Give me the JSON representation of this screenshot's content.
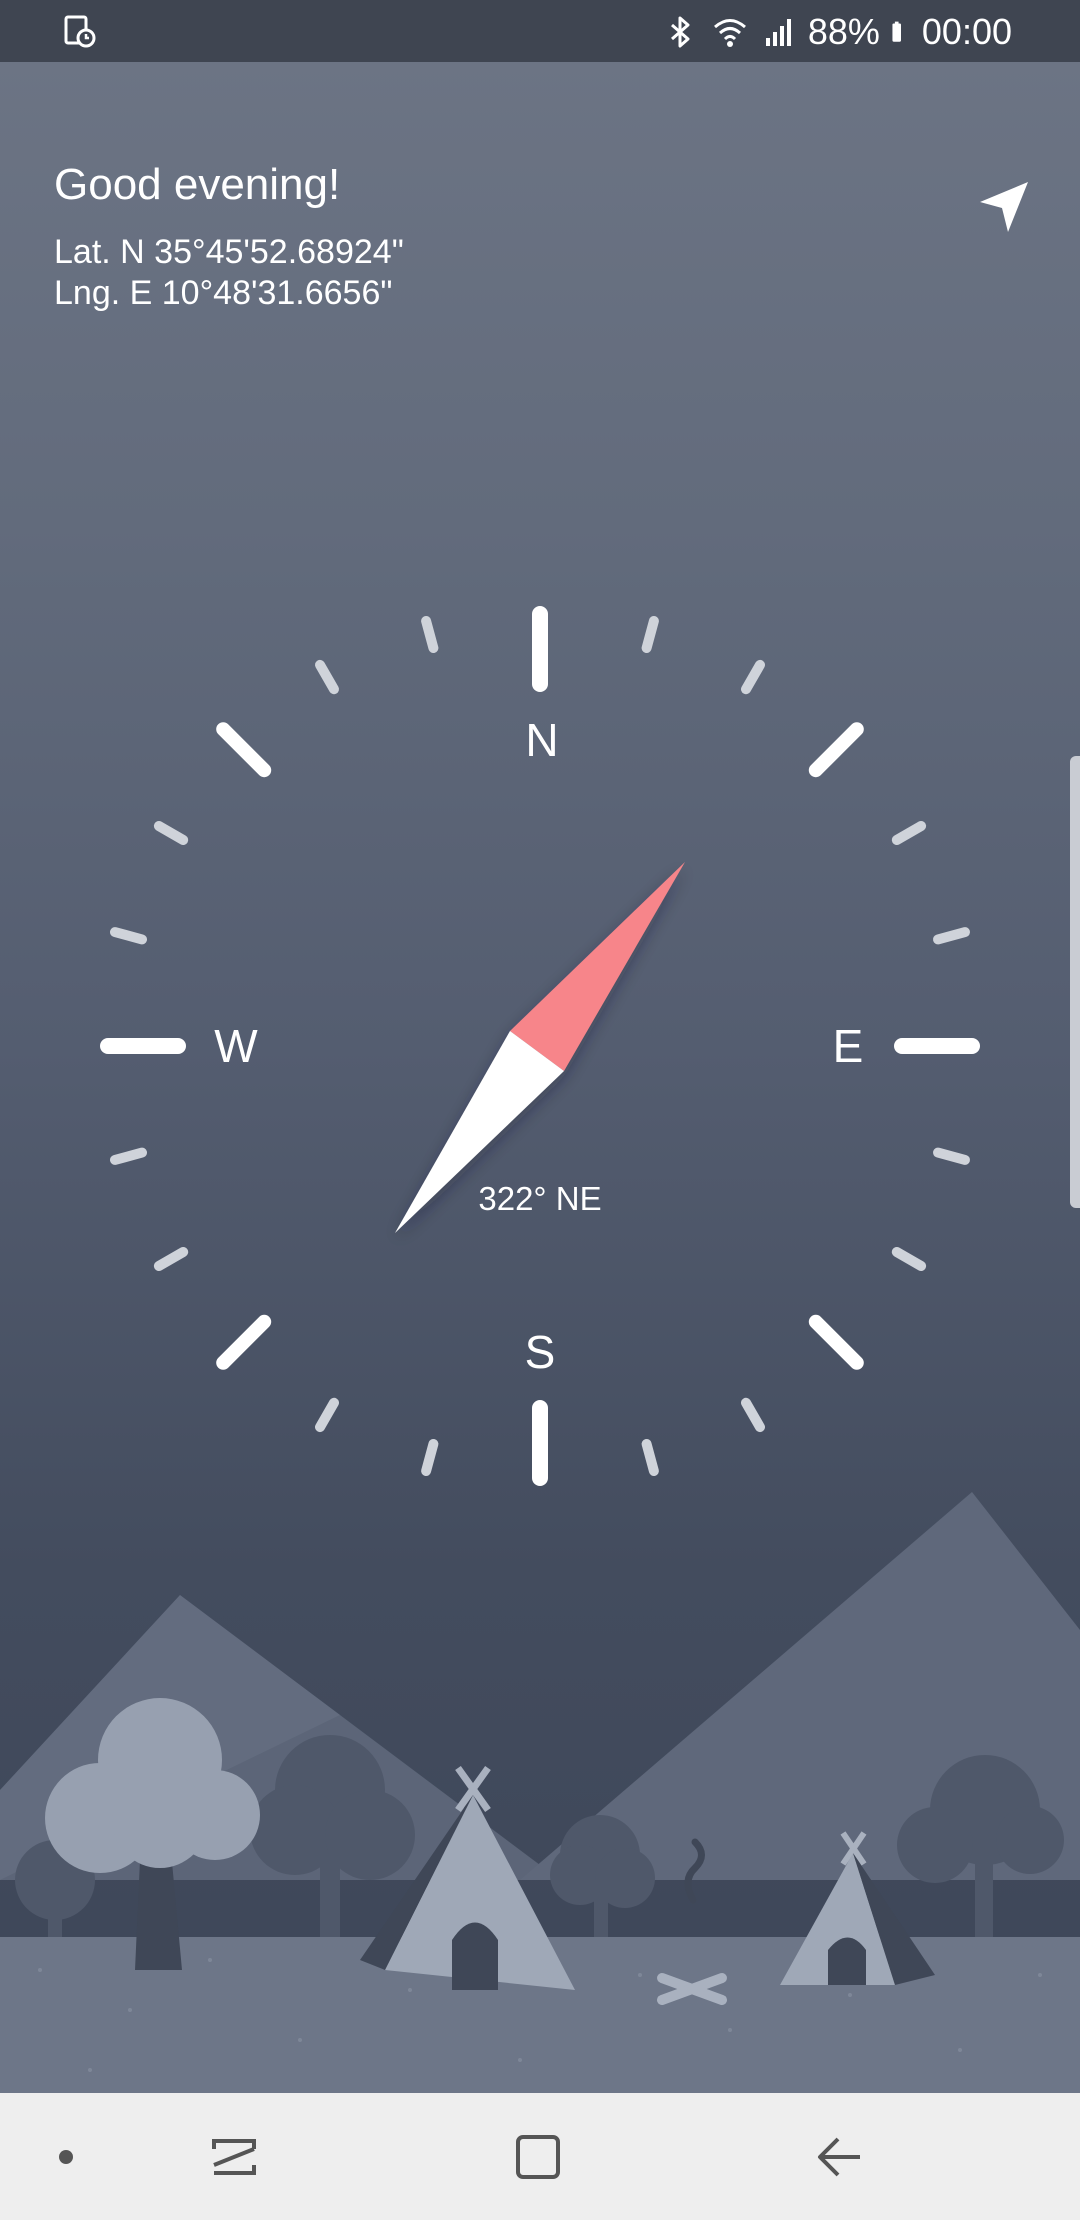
{
  "status_bar": {
    "left_icon": "screen-record-icon",
    "icons": [
      "bluetooth-icon",
      "wifi-icon",
      "signal-icon"
    ],
    "battery_percent": "88%",
    "battery_icon": "battery-icon",
    "time": "00:00"
  },
  "header": {
    "greeting": "Good evening!",
    "latitude": "Lat.  N 35°45'52.68924\"",
    "longitude": "Lng. E 10°48'31.6656\""
  },
  "location_button": {
    "icon": "location-arrow-icon"
  },
  "compass": {
    "cardinals": {
      "n": "N",
      "e": "E",
      "s": "S",
      "w": "W"
    },
    "heading_degrees": 322,
    "heading_label": "322° NE",
    "needle_north_color": "#f7858a",
    "needle_south_color": "#ffffff"
  },
  "navbar": {
    "buttons": [
      "dot-icon",
      "recent-apps-icon",
      "home-icon",
      "back-icon"
    ]
  },
  "colors": {
    "status_bar": "#3f4551",
    "navbar": "#eeeeee"
  }
}
